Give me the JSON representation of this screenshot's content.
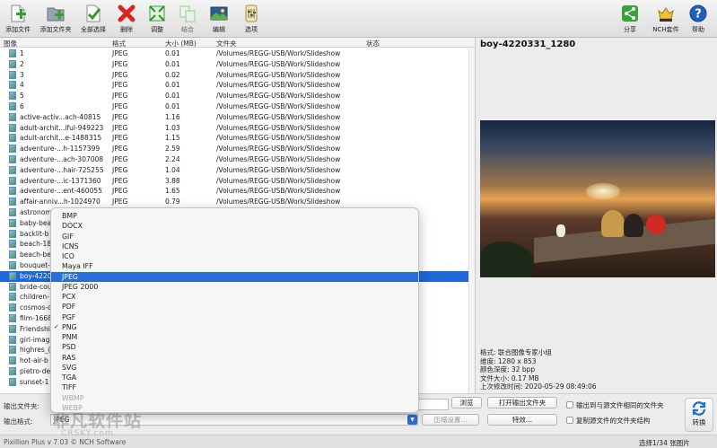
{
  "toolbar": {
    "add_files": "添加文件",
    "add_folder": "添加文件夹",
    "select_all": "全部选择",
    "delete": "删除",
    "adjust": "调整",
    "combine": "结合",
    "edit": "编辑",
    "options": "选项",
    "share": "分享",
    "nch_suite": "NCH套件",
    "help": "帮助"
  },
  "table": {
    "headers": {
      "image": "图像",
      "format": "格式",
      "size": "大小 (MB)",
      "folder": "文件夹",
      "status": "状态"
    },
    "rows": [
      {
        "name": "1",
        "format": "JPEG",
        "size": "0.01",
        "folder": "/Volumes/REGG-USB/Work/Slideshow"
      },
      {
        "name": "2",
        "format": "JPEG",
        "size": "0.01",
        "folder": "/Volumes/REGG-USB/Work/Slideshow"
      },
      {
        "name": "3",
        "format": "JPEG",
        "size": "0.02",
        "folder": "/Volumes/REGG-USB/Work/Slideshow"
      },
      {
        "name": "4",
        "format": "JPEG",
        "size": "0.01",
        "folder": "/Volumes/REGG-USB/Work/Slideshow"
      },
      {
        "name": "5",
        "format": "JPEG",
        "size": "0.01",
        "folder": "/Volumes/REGG-USB/Work/Slideshow"
      },
      {
        "name": "6",
        "format": "JPEG",
        "size": "0.01",
        "folder": "/Volumes/REGG-USB/Work/Slideshow"
      },
      {
        "name": "active-activ...ach-40815",
        "format": "JPEG",
        "size": "1.16",
        "folder": "/Volumes/REGG-USB/Work/Slideshow"
      },
      {
        "name": "adult-archit...iful-949223",
        "format": "JPEG",
        "size": "1.03",
        "folder": "/Volumes/REGG-USB/Work/Slideshow"
      },
      {
        "name": "adult-archit...e-1488315",
        "format": "JPEG",
        "size": "1.15",
        "folder": "/Volumes/REGG-USB/Work/Slideshow"
      },
      {
        "name": "adventure-...h-1157399",
        "format": "JPEG",
        "size": "2.59",
        "folder": "/Volumes/REGG-USB/Work/Slideshow"
      },
      {
        "name": "adventure-...ach-307008",
        "format": "JPEG",
        "size": "2.24",
        "folder": "/Volumes/REGG-USB/Work/Slideshow"
      },
      {
        "name": "adventure-...hair-725255",
        "format": "JPEG",
        "size": "1.04",
        "folder": "/Volumes/REGG-USB/Work/Slideshow"
      },
      {
        "name": "adventure-...ic-1371360",
        "format": "JPEG",
        "size": "3.88",
        "folder": "/Volumes/REGG-USB/Work/Slideshow"
      },
      {
        "name": "adventure-...ent-460055",
        "format": "JPEG",
        "size": "1.65",
        "folder": "/Volumes/REGG-USB/Work/Slideshow"
      },
      {
        "name": "affair-anniv...h-1024970",
        "format": "JPEG",
        "size": "0.79",
        "folder": "/Volumes/REGG-USB/Work/Slideshow"
      },
      {
        "name": "astronom",
        "format": "",
        "size": "",
        "folder": ""
      },
      {
        "name": "baby-bea",
        "format": "",
        "size": "",
        "folder": ""
      },
      {
        "name": "backlit-b",
        "format": "",
        "size": "",
        "folder": ""
      },
      {
        "name": "beach-18",
        "format": "",
        "size": "",
        "folder": ""
      },
      {
        "name": "beach-be",
        "format": "",
        "size": "",
        "folder": ""
      },
      {
        "name": "bouquet-",
        "format": "",
        "size": "",
        "folder": ""
      },
      {
        "name": "boy-4220",
        "format": "",
        "size": "",
        "folder": "",
        "selected": true
      },
      {
        "name": "bride-cou",
        "format": "",
        "size": "",
        "folder": ""
      },
      {
        "name": "children-",
        "format": "",
        "size": "",
        "folder": ""
      },
      {
        "name": "cosmos-c",
        "format": "",
        "size": "",
        "folder": ""
      },
      {
        "name": "film-1668",
        "format": "",
        "size": "",
        "folder": ""
      },
      {
        "name": "Friendshi",
        "format": "",
        "size": "",
        "folder": ""
      },
      {
        "name": "girl-imag",
        "format": "",
        "size": "",
        "folder": ""
      },
      {
        "name": "highres_(",
        "format": "",
        "size": "",
        "folder": ""
      },
      {
        "name": "hot-air-b",
        "format": "",
        "size": "",
        "folder": ""
      },
      {
        "name": "pietro-de",
        "format": "",
        "size": "",
        "folder": ""
      },
      {
        "name": "sunset-1",
        "format": "",
        "size": "",
        "folder": ""
      }
    ]
  },
  "preview": {
    "title": "boy-4220331_1280",
    "info": [
      "格式: 联合图像专家小组",
      "维度: 1280 x 853",
      "颜色深度: 32 bpp",
      "文件大小: 0.17 MB",
      "上次修改时间: 2020-05-29 08:49:06"
    ]
  },
  "bottom": {
    "output_folder_label": "输出文件夹:",
    "output_format_label": "输出格式:",
    "output_format_value": "JPEG",
    "browse": "浏览",
    "open_output_folder": "打开输出文件夹",
    "compression_settings": "压缩设置...",
    "effects": "特效...",
    "output_to_source": "输出到与源文件相同的文件夹",
    "copy_structure": "复制源文件的文件夹结构",
    "convert": "转换"
  },
  "status": {
    "version": "Pixillion Plus v 7.03 © NCH Software",
    "selection": "选择1/34 张图片"
  },
  "dropdown": {
    "items": [
      {
        "label": "BMP"
      },
      {
        "label": "DOCX"
      },
      {
        "label": "GIF"
      },
      {
        "label": "ICNS"
      },
      {
        "label": "ICO"
      },
      {
        "label": "Maya IFF"
      },
      {
        "label": "JPEG",
        "highlighted": true
      },
      {
        "label": "JPEG 2000"
      },
      {
        "label": "PCX"
      },
      {
        "label": "PDF"
      },
      {
        "label": "PGF"
      },
      {
        "label": "PNG",
        "checked": true
      },
      {
        "label": "PNM"
      },
      {
        "label": "PSD"
      },
      {
        "label": "RAS"
      },
      {
        "label": "SVG"
      },
      {
        "label": "TGA"
      },
      {
        "label": "TIFF"
      },
      {
        "label": "WBMP",
        "disabled": true
      },
      {
        "label": "WEBP",
        "disabled": true
      }
    ]
  },
  "watermark": {
    "main": "非凡软件站",
    "sub": "CRSKY.com"
  },
  "colors": {
    "selection": "#1e68d9",
    "menu_highlight": "#2a6fd6",
    "delete_red": "#d9271f",
    "accent_green": "#3aa23a"
  }
}
